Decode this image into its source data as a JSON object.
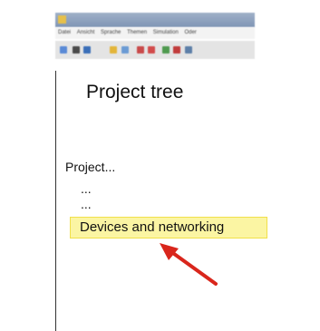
{
  "window": {
    "title": "",
    "menu": [
      "Datei",
      "Ansicht",
      "Sprache",
      "Themen",
      "Simulation",
      "Oder"
    ]
  },
  "toolbar": {
    "icons": [
      "open-icon",
      "save-icon",
      "print-icon",
      "folder-icon",
      "network-icon",
      "cut-icon",
      "delete-icon",
      "download-icon",
      "upload-icon",
      "settings-icon"
    ]
  },
  "panel": {
    "title": "Project tree"
  },
  "tree": {
    "root": "Project...",
    "items": [
      "...",
      "..."
    ],
    "highlighted_item": "Devices and networking"
  },
  "colors": {
    "highlight_fill": "#fbf5a3",
    "highlight_border": "#f1e04a",
    "arrow": "#d9261c"
  }
}
